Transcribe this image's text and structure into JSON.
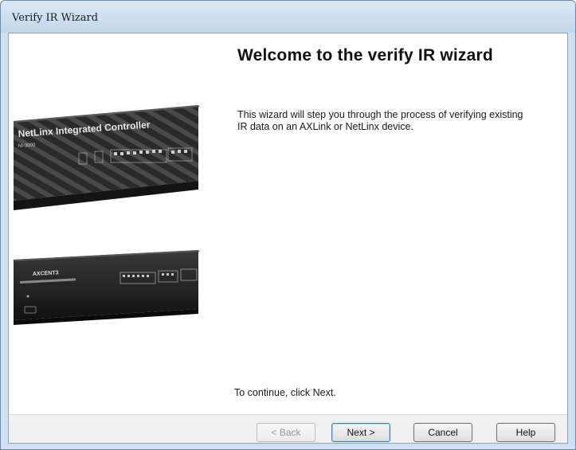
{
  "window": {
    "title": "Verify IR Wizard"
  },
  "wizard": {
    "heading": "Welcome to the verify IR wizard",
    "description_line1": "This wizard will step you through the process of verifying existing",
    "description_line2": "IR data on an AXLink or NetLinx device.",
    "continue_hint": "To continue, click Next."
  },
  "device_image": {
    "controller_label": "NetLinx Integrated Controller",
    "controller_model": "NI-3000",
    "axcent_label": "AXCENT3"
  },
  "buttons": {
    "back": "< Back",
    "next": "Next >",
    "cancel": "Cancel",
    "help": "Help"
  }
}
